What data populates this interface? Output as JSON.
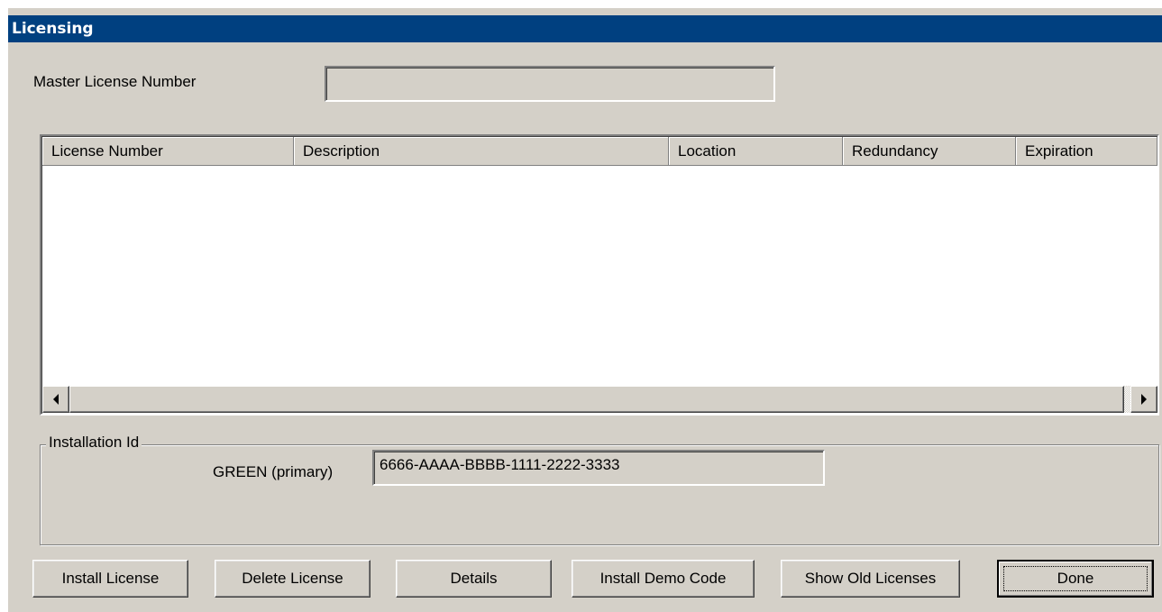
{
  "window": {
    "title": "Licensing"
  },
  "master_license": {
    "label": "Master License Number",
    "value": ""
  },
  "license_table": {
    "columns": [
      "License Number",
      "Description",
      "Location",
      "Redundancy",
      "Expiration"
    ],
    "rows": []
  },
  "installation": {
    "group_label": "Installation Id",
    "host_label": "GREEN (primary)",
    "id_value": "6666-AAAA-BBBB-1111-2222-3333"
  },
  "buttons": {
    "install_license": "Install License",
    "delete_license": "Delete License",
    "details": "Details",
    "install_demo_code": "Install Demo Code",
    "show_old_licenses": "Show Old Licenses",
    "done": "Done"
  },
  "icons": {
    "scroll_left": "arrow-left-icon",
    "scroll_right": "arrow-right-icon"
  },
  "colors": {
    "titlebar": "#004080",
    "dialog_bg": "#d4d0c8"
  }
}
